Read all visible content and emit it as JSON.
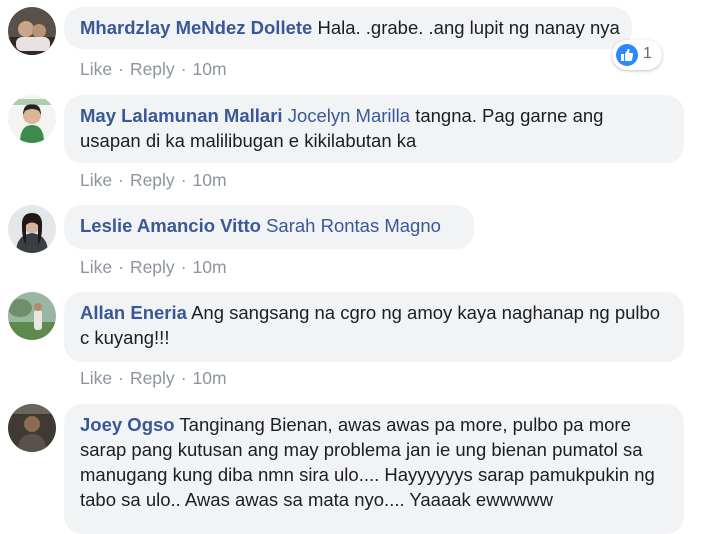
{
  "comments": [
    {
      "author": "Mhardzlay MeNdez Dollete",
      "tag": "",
      "text": "Hala. .grabe. .ang lupit ng nanay nya",
      "actions": {
        "like": "Like",
        "reply": "Reply",
        "time": "10m"
      },
      "reaction": {
        "icon": "thumbs-up-icon",
        "count": "1"
      }
    },
    {
      "author": "May Lalamunan Mallari",
      "tag": "Jocelyn Marilla",
      "text": "tangna. Pag garne ang usapan di ka malilibugan e kikilabutan ka",
      "actions": {
        "like": "Like",
        "reply": "Reply",
        "time": "10m"
      }
    },
    {
      "author": "Leslie Amancio Vitto",
      "tag": "Sarah Rontas Magno",
      "text": "",
      "actions": {
        "like": "Like",
        "reply": "Reply",
        "time": "10m"
      }
    },
    {
      "author": "Allan Eneria",
      "tag": "",
      "text": "Ang sangsang na cgro ng amoy kaya naghanap ng pulbo c kuyang!!!",
      "actions": {
        "like": "Like",
        "reply": "Reply",
        "time": "10m"
      }
    },
    {
      "author": "Joey Ogso",
      "tag": "",
      "text": "Tanginang Bienan, awas awas pa more, pulbo pa more sarap pang kutusan ang may problema jan ie ung bienan pumatol sa manugang kung diba nmn sira ulo.... Hayyyyyys sarap pamukpukin ng tabo sa ulo.. Awas awas sa mata nyo.... Yaaaak ewwwww"
    }
  ],
  "separator": "·",
  "colors": {
    "link": "#385898",
    "bubble": "#f2f3f5",
    "meta": "#8d949e",
    "like": "#2d88ff"
  }
}
